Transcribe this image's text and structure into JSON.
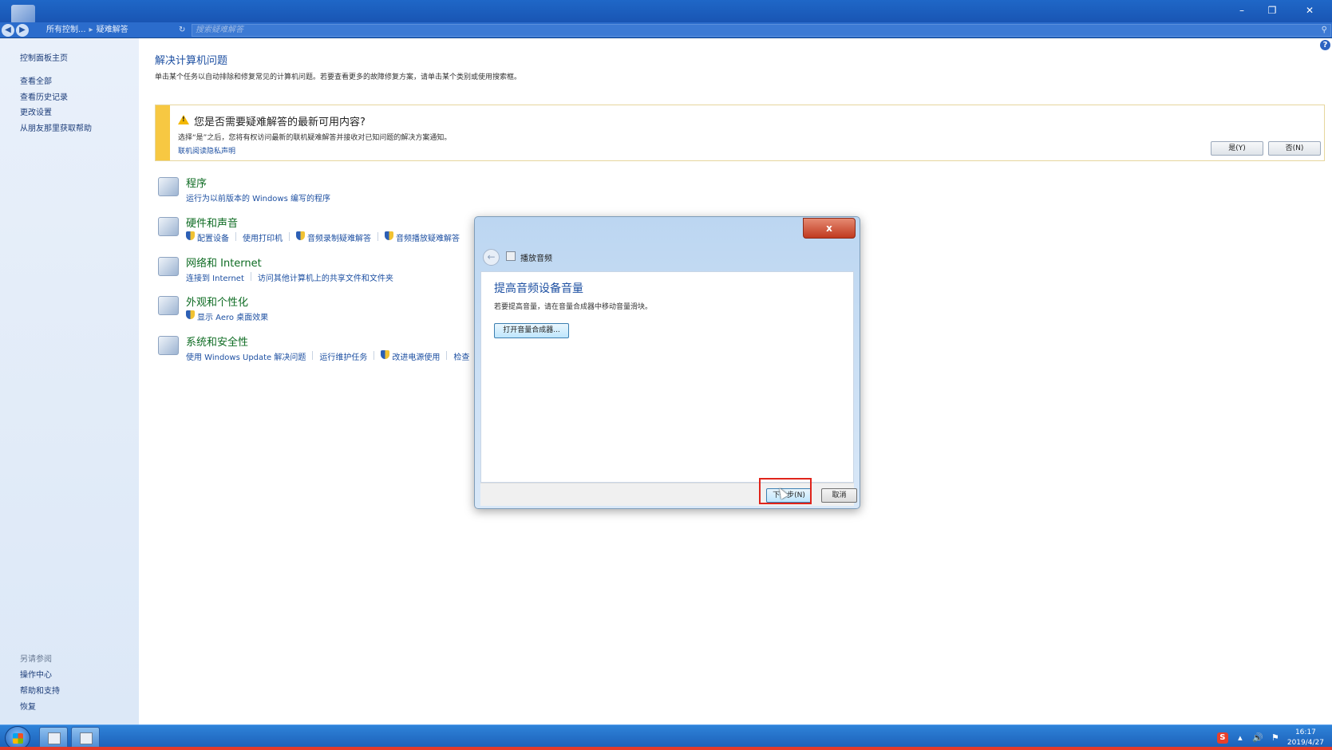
{
  "window": {
    "minimize_glyph": "–",
    "restore_glyph": "❐",
    "close_glyph": "✕"
  },
  "address": {
    "crumb1": "所有控制...",
    "crumb2": "疑难解答",
    "search_placeholder": "搜索疑难解答"
  },
  "sidebar": {
    "home": "控制面板主页",
    "items": [
      "查看全部",
      "查看历史记录",
      "更改设置",
      "从朋友那里获取帮助"
    ],
    "see_also": "另请参阅",
    "see_also_items": [
      "操作中心",
      "帮助和支持",
      "恢复"
    ]
  },
  "main": {
    "title": "解决计算机问题",
    "description": "单击某个任务以自动排除和修复常见的计算机问题。若要查看更多的故障修复方案，请单击某个类别或使用搜索框。"
  },
  "banner": {
    "title": "您是否需要疑难解答的最新可用内容?",
    "text": "选择“是”之后，您将有权访问最新的联机疑难解答并接收对已知问题的解决方案通知。",
    "privacy_link": "联机阅读隐私声明",
    "yes_button": "是(Y)",
    "no_button": "否(N)"
  },
  "categories": [
    {
      "title": "程序",
      "links": [
        "运行为以前版本的 Windows 编写的程序"
      ]
    },
    {
      "title": "硬件和声音",
      "links": [
        "配置设备",
        "使用打印机",
        "音频录制疑难解答",
        "音频播放疑难解答"
      ]
    },
    {
      "title": "网络和 Internet",
      "links": [
        "连接到 Internet",
        "访问其他计算机上的共享文件和文件夹"
      ]
    },
    {
      "title": "外观和个性化",
      "links": [
        "显示 Aero 桌面效果"
      ]
    },
    {
      "title": "系统和安全性",
      "links": [
        "使用 Windows Update 解决问题",
        "运行维护任务",
        "改进电源使用",
        "检查"
      ]
    }
  ],
  "dialog": {
    "title": "播放音频",
    "heading": "提高音频设备音量",
    "text": "若要提高音量，请在音量合成器中移动音量滑块。",
    "mixer_button": "打开音量合成器...",
    "next_button": "下一步(N)",
    "cancel_button": "取消",
    "close_glyph": "x"
  },
  "taskbar": {
    "time": "16:17",
    "date": "2019/4/27",
    "ime_label": "S"
  },
  "colors": {
    "accent": "#1e50a2",
    "category_title": "#0d6b22",
    "highlight": "#e0241b",
    "banner_stripe": "#f7c842"
  }
}
